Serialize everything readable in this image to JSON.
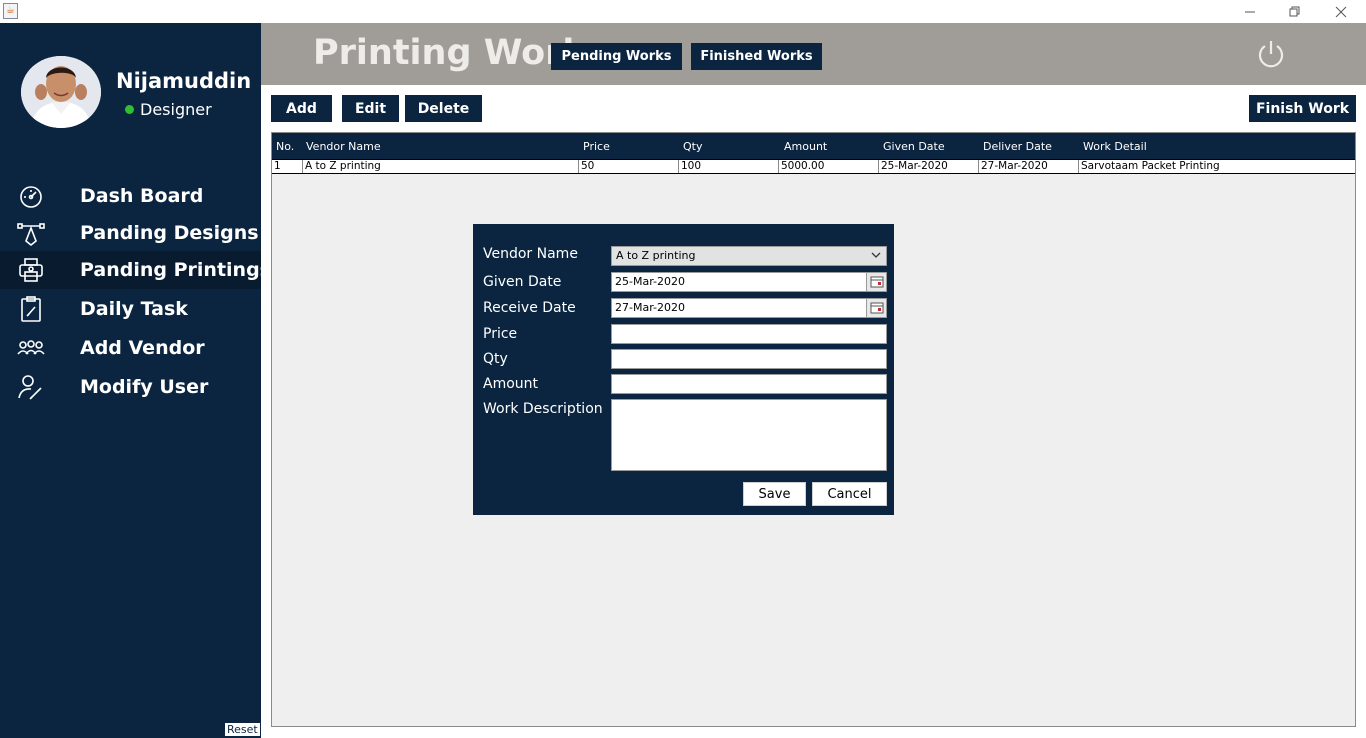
{
  "window": {
    "app_icon": "java-cup-icon",
    "controls": [
      "minimize",
      "restore",
      "close"
    ]
  },
  "sidebar": {
    "user_name": "Nijamuddin",
    "user_role": "Designer",
    "status_color": "#2fbf2f",
    "items": [
      {
        "label": "Dash Board",
        "icon": "dashboard-gauge-icon",
        "active": false
      },
      {
        "label": "Panding Designs",
        "icon": "vector-pen-icon",
        "active": false
      },
      {
        "label": "Panding Printings",
        "icon": "printer-icon",
        "active": true
      },
      {
        "label": "Daily Task",
        "icon": "clipboard-pencil-icon",
        "active": false
      },
      {
        "label": "Add Vendor",
        "icon": "group-users-icon",
        "active": false
      },
      {
        "label": "Modify User",
        "icon": "user-edit-icon",
        "active": false
      }
    ],
    "reset_label": "Reset"
  },
  "header": {
    "title": "Printing Work",
    "pending_label": "Pending Works",
    "finished_label": "Finished Works",
    "power_icon": "power-icon"
  },
  "toolbar": {
    "add_label": "Add",
    "edit_label": "Edit",
    "delete_label": "Delete",
    "finish_label": "Finish Work"
  },
  "table": {
    "columns": [
      "No.",
      "Vendor Name",
      "Price",
      "Qty",
      "Amount",
      "Given Date",
      "Deliver Date",
      "Work Detail"
    ],
    "rows": [
      [
        "1",
        "A to Z printing",
        "50",
        "100",
        "5000.00",
        "25-Mar-2020",
        "27-Mar-2020",
        "Sarvotaam Packet Printing"
      ]
    ]
  },
  "form": {
    "vendor_label": "Vendor Name",
    "vendor_value": "A to Z printing",
    "given_label": "Given Date",
    "given_value": "25-Mar-2020",
    "receive_label": "Receive Date",
    "receive_value": "27-Mar-2020",
    "price_label": "Price",
    "price_value": "",
    "qty_label": "Qty",
    "qty_value": "",
    "amount_label": "Amount",
    "amount_value": "",
    "desc_label": "Work Description",
    "desc_value": "",
    "save_label": "Save",
    "cancel_label": "Cancel"
  },
  "colors": {
    "navy": "#0b2540",
    "header_gray": "#a09d98",
    "panel_gray": "#efefef"
  }
}
